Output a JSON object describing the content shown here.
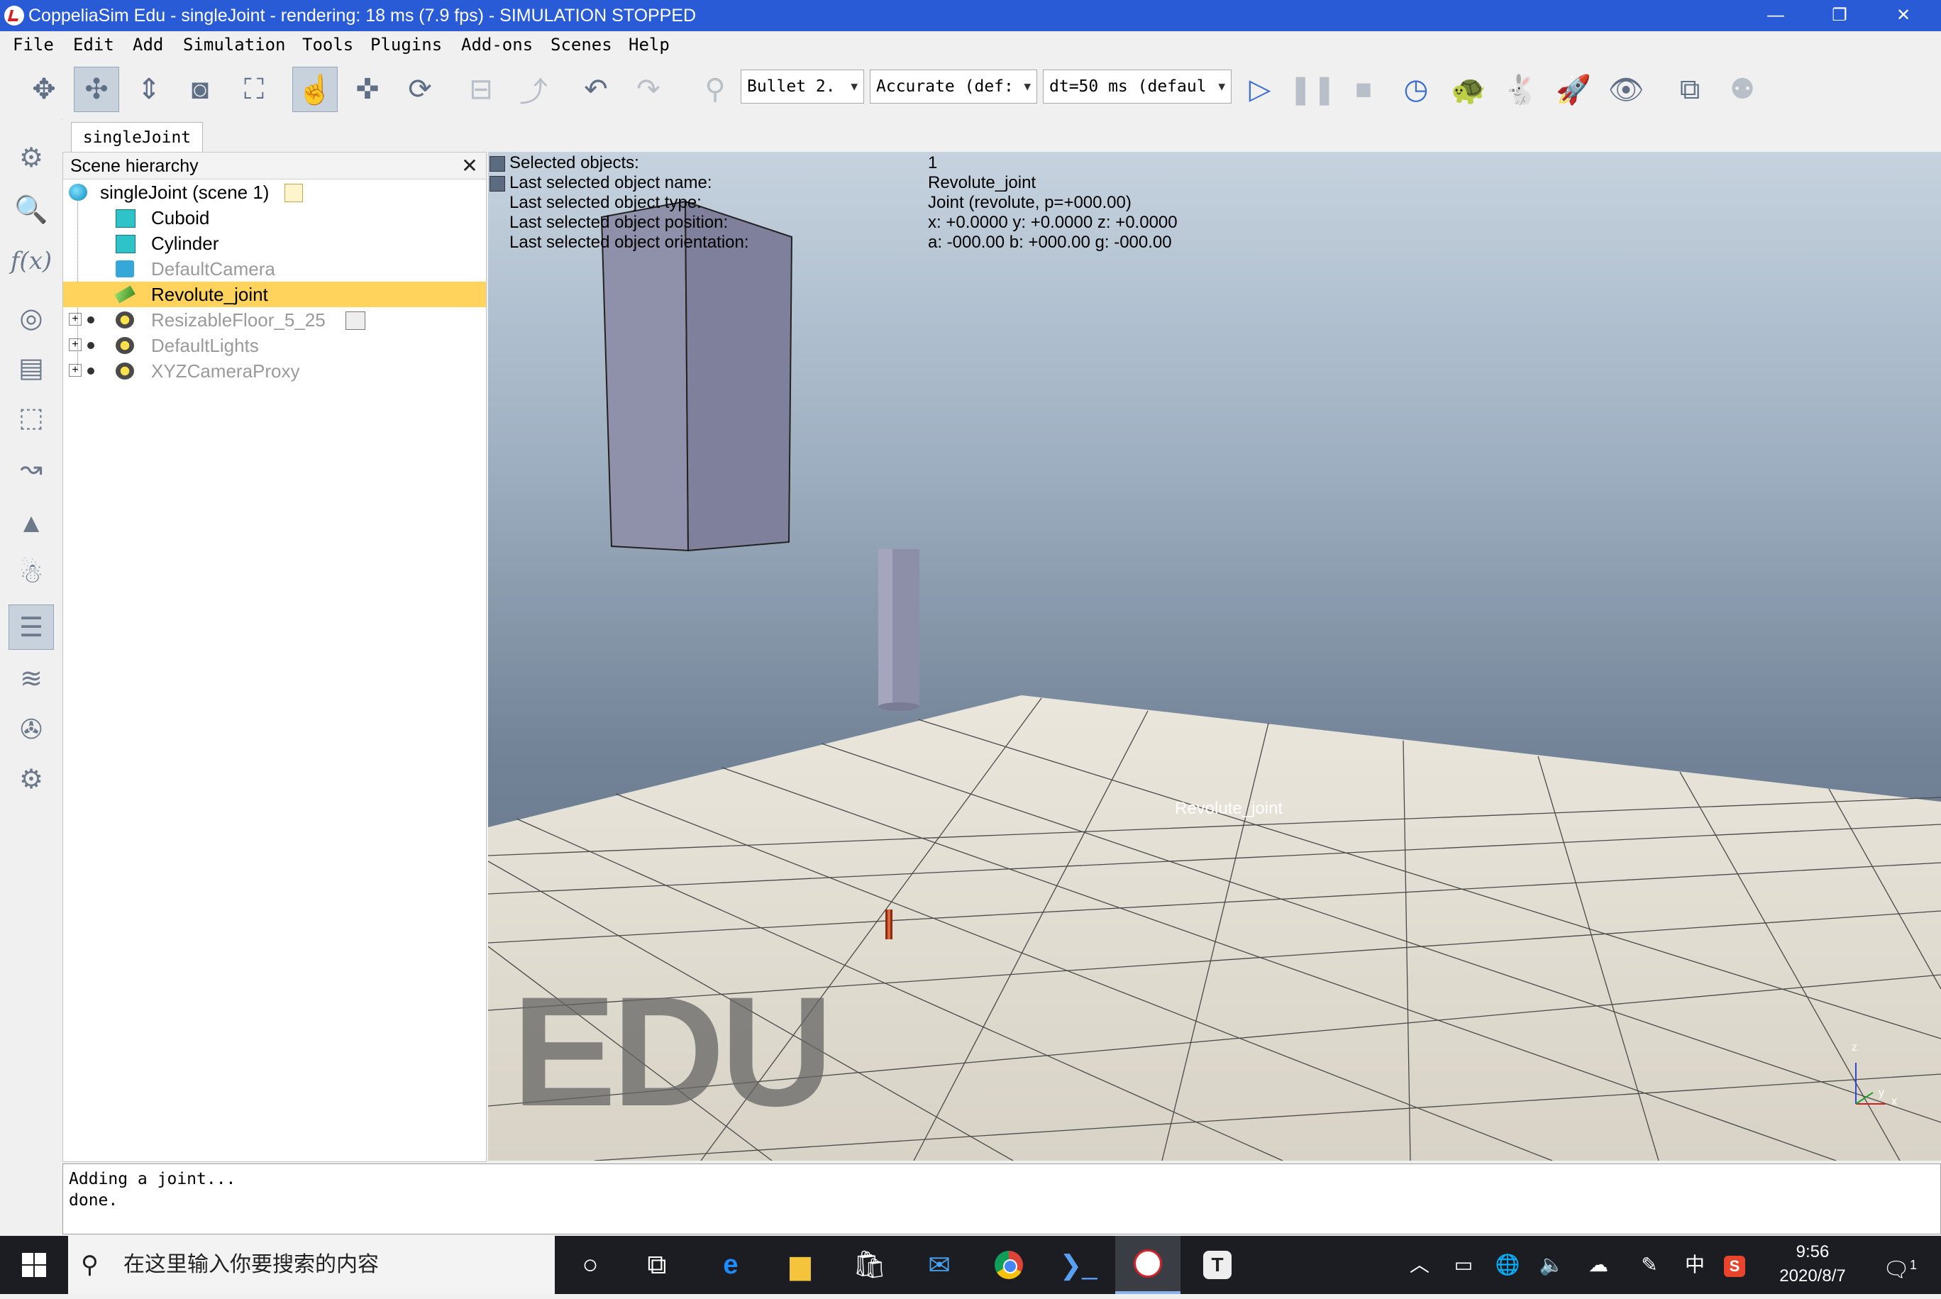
{
  "window": {
    "title": "CoppeliaSim Edu - singleJoint - rendering: 18 ms (7.9 fps) - SIMULATION STOPPED",
    "controls": {
      "minimize": "—",
      "restore": "❐",
      "close": "✕"
    }
  },
  "menu": [
    "File",
    "Edit",
    "Add",
    "Simulation",
    "Tools",
    "Plugins",
    "Add-ons",
    "Scenes",
    "Help"
  ],
  "toolbar": {
    "engine": "Bullet 2.",
    "accuracy": "Accurate (def:",
    "timestep": "dt=50 ms (defaul"
  },
  "scene_tab": "singleJoint",
  "hierarchy": {
    "header": "Scene hierarchy",
    "items": [
      {
        "label": "singleJoint (scene 1)",
        "icon": "globe-icon"
      },
      {
        "label": "Cuboid",
        "icon": "cube-icon"
      },
      {
        "label": "Cylinder",
        "icon": "cube-icon"
      },
      {
        "label": "DefaultCamera",
        "icon": "camera-icon"
      },
      {
        "label": "Revolute_joint",
        "icon": "joint-icon",
        "selected": true
      },
      {
        "label": "ResizableFloor_5_25",
        "icon": "model-icon"
      },
      {
        "label": "DefaultLights",
        "icon": "model-icon"
      },
      {
        "label": "XYZCameraProxy",
        "icon": "model-icon"
      }
    ]
  },
  "info": {
    "rows": [
      {
        "key": "Selected objects:",
        "value": "1"
      },
      {
        "key": "Last selected object name:",
        "value": "Revolute_joint"
      },
      {
        "key": "Last selected object type:",
        "value": "Joint (revolute, p=+000.00)"
      },
      {
        "key": "Last selected object position:",
        "value": "x: +0.0000    y: +0.0000    z: +0.0000"
      },
      {
        "key": "Last selected object orientation:",
        "value": "a: -000.00    b: +000.00    g: -000.00"
      }
    ]
  },
  "viewport": {
    "joint_label": "Revolute_joint",
    "watermark": "EDU",
    "axes": {
      "z": "z",
      "y": "y",
      "x": "x"
    }
  },
  "console": {
    "lines": [
      "Adding a joint...",
      "done."
    ]
  },
  "taskbar": {
    "search_placeholder": "在这里输入你要搜索的内容",
    "ime": "中",
    "time": "9:56",
    "date": "2020/8/7",
    "notification_count": "1"
  }
}
